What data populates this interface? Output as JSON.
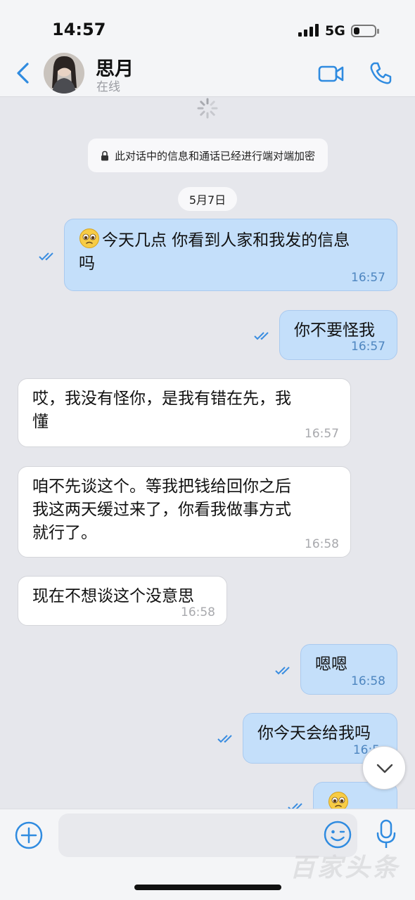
{
  "status_bar": {
    "time": "14:57",
    "network": "5G",
    "battery_level": 0.3
  },
  "header": {
    "contact_name": "思月",
    "contact_status": "在线"
  },
  "encryption_notice": "此对话中的信息和通话已经进行端对端加密",
  "date_separator": "5月7日",
  "messages": [
    {
      "direction": "out",
      "emoji": "pleading-face",
      "text": "今天几点 你看到人家和我发的信息\n吗",
      "time": "16:57",
      "status": "read"
    },
    {
      "direction": "out",
      "text": "你不要怪我",
      "time": "16:57",
      "status": "read"
    },
    {
      "direction": "in",
      "text": "哎，我没有怪你，是我有错在先，我\n懂",
      "time": "16:57"
    },
    {
      "direction": "in",
      "text": "咱不先谈这个。等我把钱给回你之后\n我这两天缓过来了，你看我做事方式\n就行了。",
      "time": "16:58"
    },
    {
      "direction": "in",
      "text": "现在不想谈这个没意思",
      "time": "16:58"
    },
    {
      "direction": "out",
      "text": "嗯嗯",
      "time": "16:58",
      "status": "read"
    },
    {
      "direction": "out",
      "text": "你今天会给我吗",
      "time": "16:5",
      "status": "read"
    },
    {
      "direction": "out",
      "emoji": "pleading-face",
      "text": "",
      "time": "",
      "status": "read"
    }
  ],
  "composer": {
    "placeholder": ""
  },
  "watermark": "百家头条",
  "colors": {
    "accent": "#2f8be0",
    "bubble_out": "#c4dffa",
    "bubble_in": "#ffffff",
    "chat_bg": "#e6e7ec"
  }
}
